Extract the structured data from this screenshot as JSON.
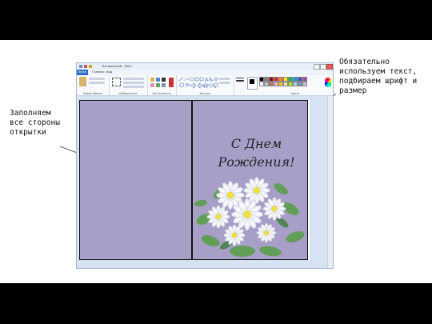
{
  "annotations": {
    "left": "Заполняем\nвсе стороны\nоткрытки",
    "right": "Обязательно\nиспользуем текст,\nподбираем шрифт и\nразмер"
  },
  "paint": {
    "title": "Безымянный - Paint",
    "tabs": [
      "Файл",
      "Главная",
      "Вид"
    ],
    "groups": [
      "Буфер обмена",
      "Изображение",
      "Инструменты",
      "Фигуры",
      "Цвета"
    ],
    "palette": [
      "#000000",
      "#7f7f7f",
      "#880015",
      "#ed1c24",
      "#ff7f27",
      "#fff200",
      "#22b14c",
      "#00a2e8",
      "#3f48cc",
      "#a349a4",
      "#ffffff",
      "#c3c3c3",
      "#b97a57",
      "#ffaec9",
      "#ffc90e",
      "#efe4b0",
      "#b5e61d",
      "#99d9ea",
      "#7092be",
      "#c8bfe7"
    ]
  },
  "card": {
    "greeting_line1": "С Днем",
    "greeting_line2": "Рождения!",
    "fill_color": "#a89fc8"
  }
}
